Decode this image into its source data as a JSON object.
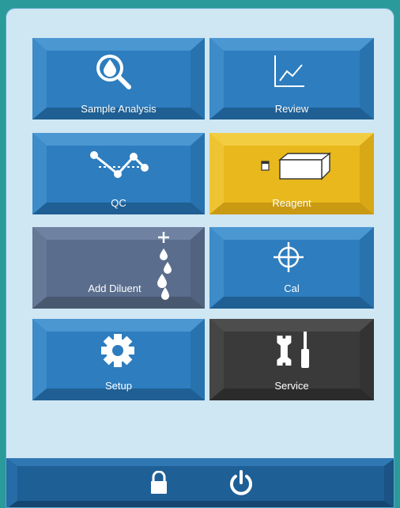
{
  "tiles": {
    "sample_analysis": {
      "label": "Sample Analysis",
      "icon": "drop-search-icon",
      "color": "#2d7dbf"
    },
    "review": {
      "label": "Review",
      "icon": "line-chart-icon",
      "color": "#2d7dbf"
    },
    "qc": {
      "label": "QC",
      "icon": "qc-chart-icon",
      "color": "#2d7dbf"
    },
    "reagent": {
      "label": "Reagent",
      "icon": "reagent-box-icon",
      "color": "#e8b81c"
    },
    "add_diluent": {
      "label": "Add Diluent",
      "icon": "diluent-drops-icon",
      "color": "#5a6d8c"
    },
    "cal": {
      "label": "Cal",
      "icon": "crosshair-icon",
      "color": "#2d7dbf"
    },
    "setup": {
      "label": "Setup",
      "icon": "gear-icon",
      "color": "#2d7dbf"
    },
    "service": {
      "label": "Service",
      "icon": "tools-icon",
      "color": "#3a3a3a"
    }
  },
  "footer": {
    "lock_icon": "lock-icon",
    "power_icon": "power-icon",
    "color": "#1e5f96"
  }
}
